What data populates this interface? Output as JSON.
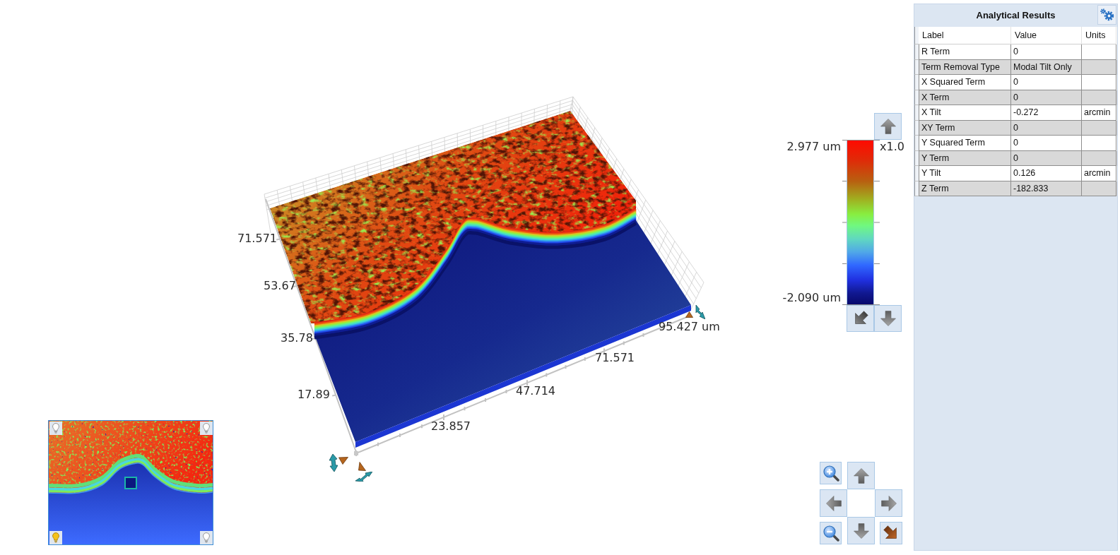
{
  "surface_plot": {
    "y_axis_labels": [
      "71.571",
      "53.67",
      "35.78",
      "17.89"
    ],
    "x_axis_labels": [
      "23.857",
      "47.714",
      "71.571",
      "95.427 um"
    ]
  },
  "color_scale": {
    "max_label": "2.977 um",
    "min_label": "-2.090 um",
    "zoom_label": "x1.0"
  },
  "minimap": {
    "lights": [
      {
        "on": false
      },
      {
        "on": false
      },
      {
        "on": true
      },
      {
        "on": false
      }
    ]
  },
  "analytical_results": {
    "title": "Analytical Results",
    "columns": [
      "Label",
      "Value",
      "Units"
    ],
    "rows": [
      {
        "label": "R Term",
        "value": "0"
      },
      {
        "label": "Term Removal Type",
        "value": "Modal Tilt Only"
      },
      {
        "label": "X Squared Term",
        "value": "0"
      },
      {
        "label": "X Term",
        "value": "0"
      },
      {
        "label": "X Tilt",
        "value": "-0.272",
        "units": "arcmin"
      },
      {
        "label": "XY Term",
        "value": "0"
      },
      {
        "label": "Y Squared Term",
        "value": "0"
      },
      {
        "label": "Y Term",
        "value": "0"
      },
      {
        "label": "Y Tilt",
        "value": "0.126",
        "units": "arcmin"
      },
      {
        "label": "Z Term",
        "value": "-182.833"
      }
    ]
  }
}
